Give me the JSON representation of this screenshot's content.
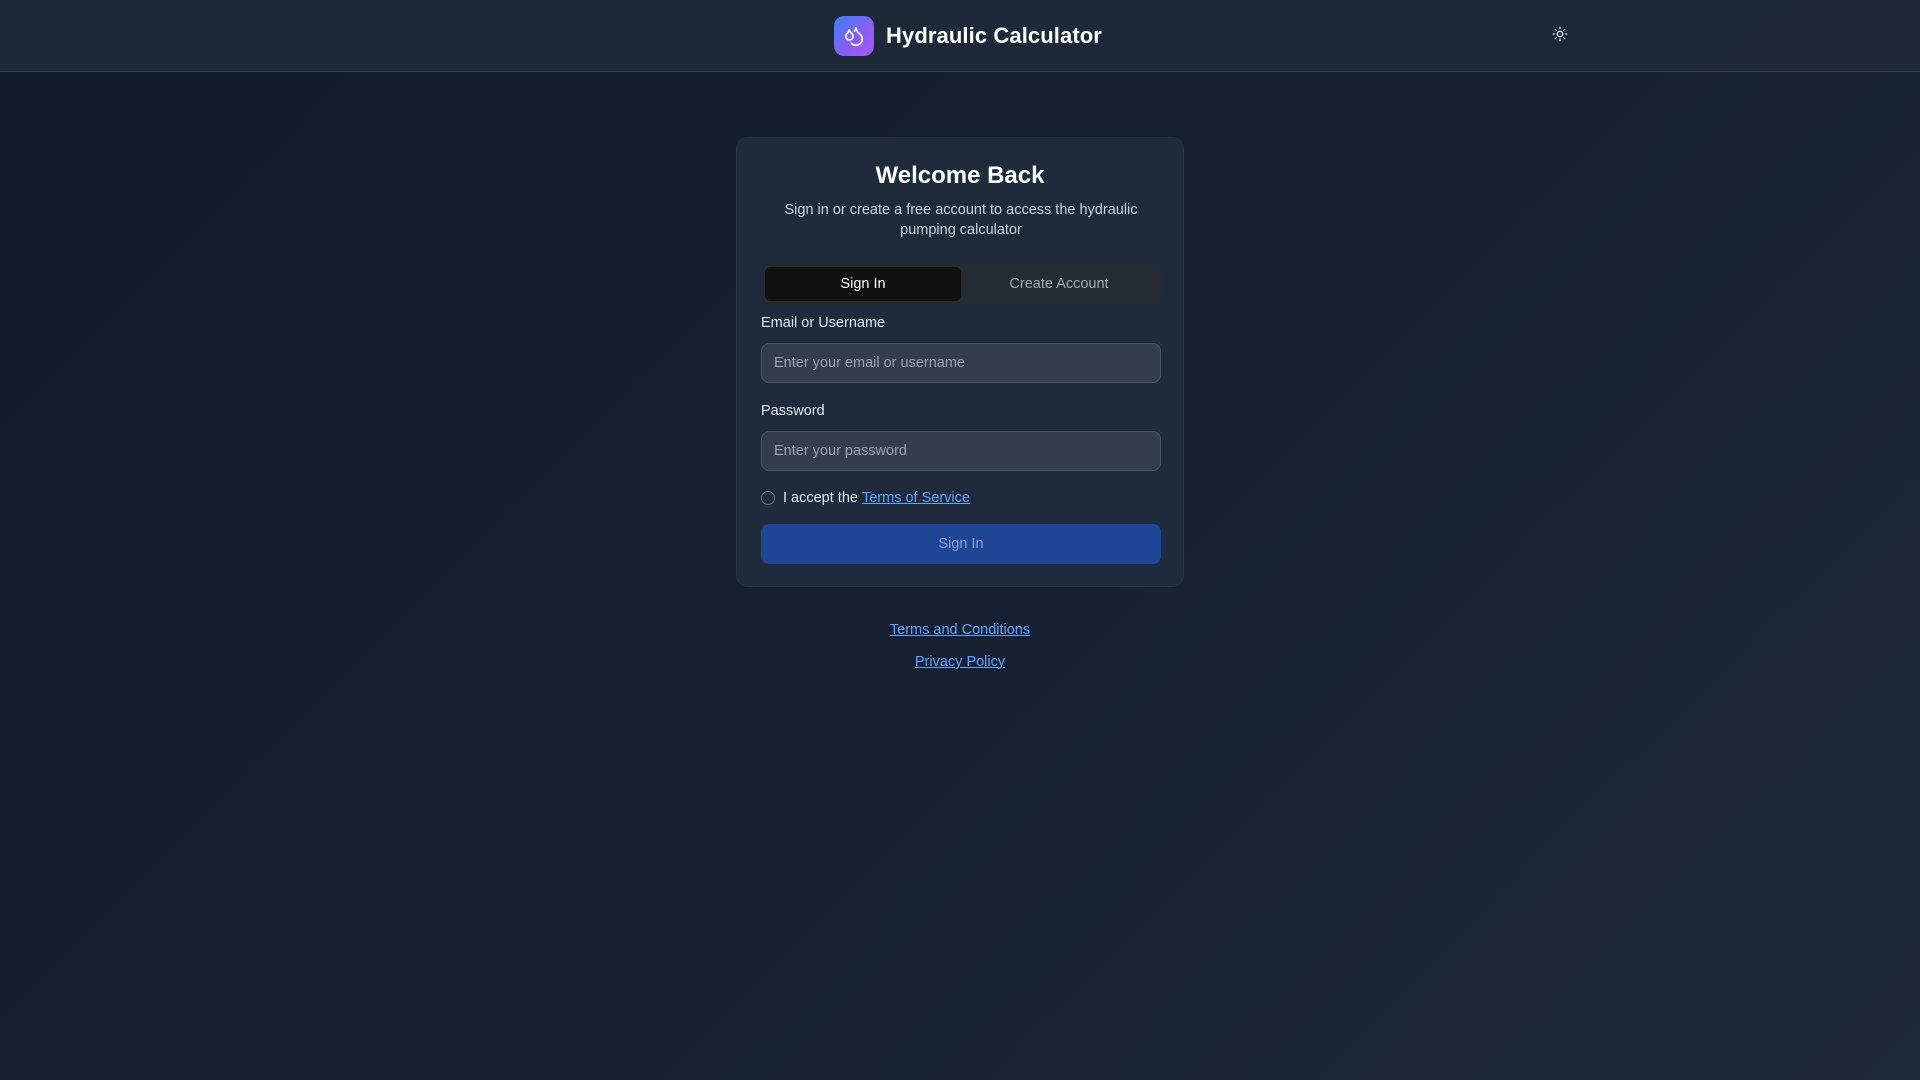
{
  "header": {
    "app_title": "Hydraulic Calculator",
    "logo_icon": "droplets-icon",
    "theme_icon": "sun-icon"
  },
  "card": {
    "title": "Welcome Back",
    "subtitle": "Sign in or create a free account to access the hydraulic pumping calculator",
    "tabs": [
      {
        "label": "Sign In",
        "active": true
      },
      {
        "label": "Create Account",
        "active": false
      }
    ],
    "email": {
      "label": "Email or Username",
      "placeholder": "Enter your email or username",
      "value": ""
    },
    "password": {
      "label": "Password",
      "placeholder": "Enter your password",
      "value": ""
    },
    "terms": {
      "prefix": "I accept the",
      "link": "Terms of Service",
      "checked": false
    },
    "submit_label": "Sign In"
  },
  "footer": {
    "terms_link": "Terms and Conditions",
    "privacy_link": "Privacy Policy"
  },
  "colors": {
    "accent": "#3b82f6",
    "link": "#60a5fa",
    "button_bg": "#1f4596",
    "logo_gradient_start": "#3b82f6",
    "logo_gradient_end": "#a855f7"
  }
}
